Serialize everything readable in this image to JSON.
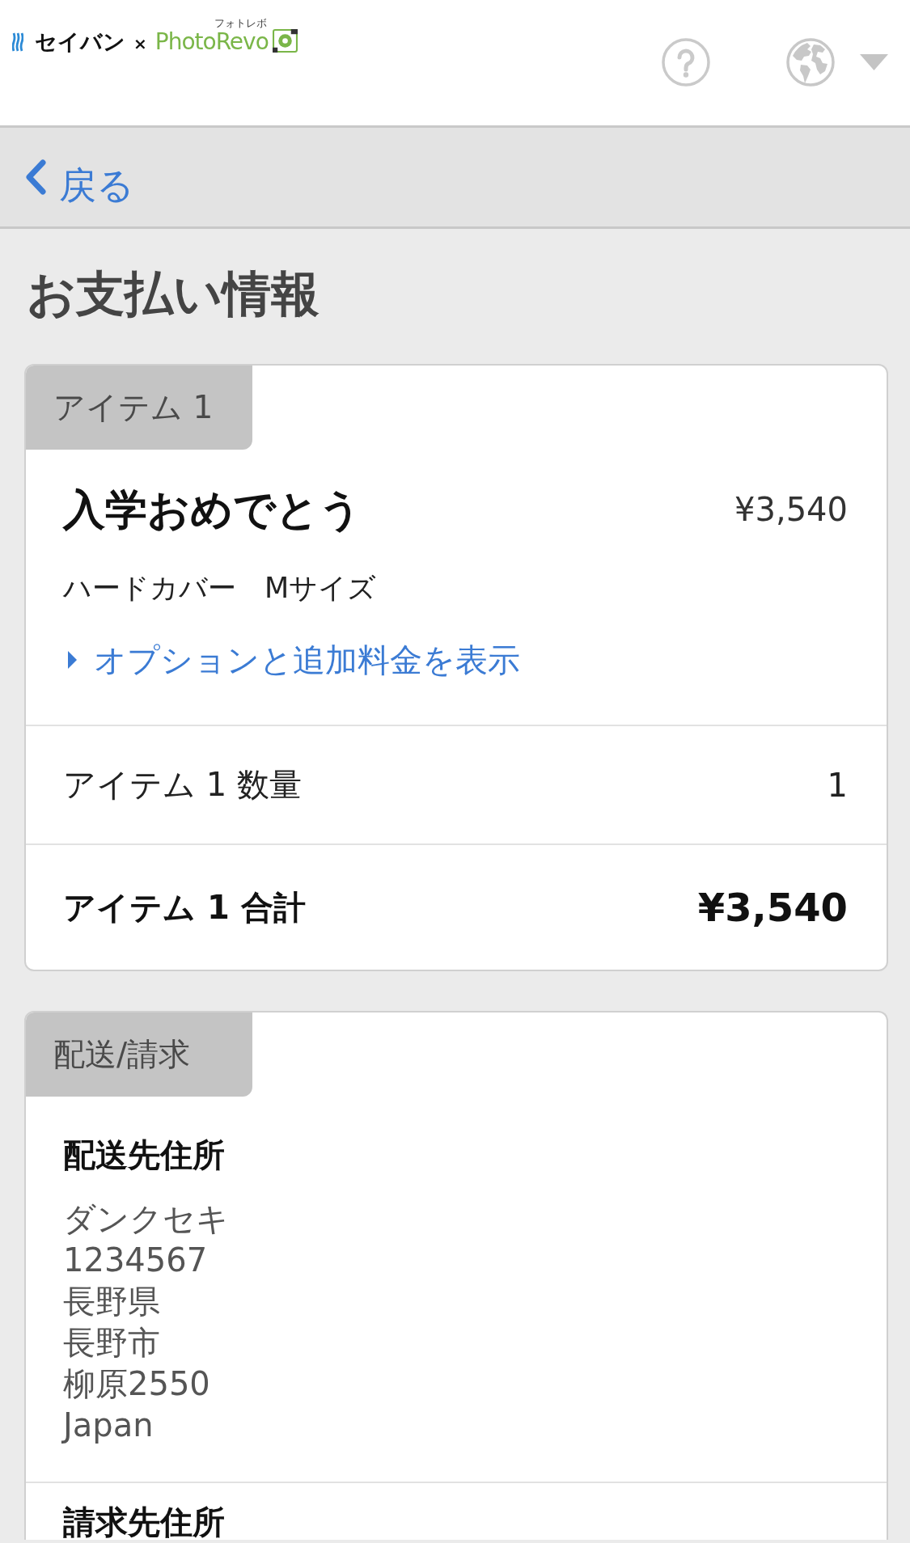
{
  "header": {
    "logo": {
      "brand": "セイバン",
      "separator": "×",
      "partner_reading": "フォトレボ",
      "partner": "PhotoRevo"
    }
  },
  "nav": {
    "back": "戻る"
  },
  "title": "お支払い情報",
  "sections": [
    {
      "kind": "item",
      "label": "アイテム 1",
      "product": {
        "name": "入学おめでとう",
        "price": "¥3,540",
        "variant": "ハードカバー　Mサイズ",
        "options_link": "オプションと追加料金を表示",
        "expanded": false
      },
      "rows": [
        {
          "kind": "quantity",
          "label": "アイテム 1 数量",
          "value": "1"
        },
        {
          "kind": "total",
          "label": "アイテム 1 合計",
          "value": "¥3,540"
        }
      ]
    },
    {
      "kind": "addresses",
      "label": "配送/請求",
      "blocks": [
        {
          "heading": "配送先住所",
          "lines": [
            "ダンクセキ",
            "1234567",
            "長野県",
            "長野市",
            "柳原2550",
            "Japan"
          ]
        },
        {
          "heading": "請求先住所"
        }
      ]
    }
  ]
}
